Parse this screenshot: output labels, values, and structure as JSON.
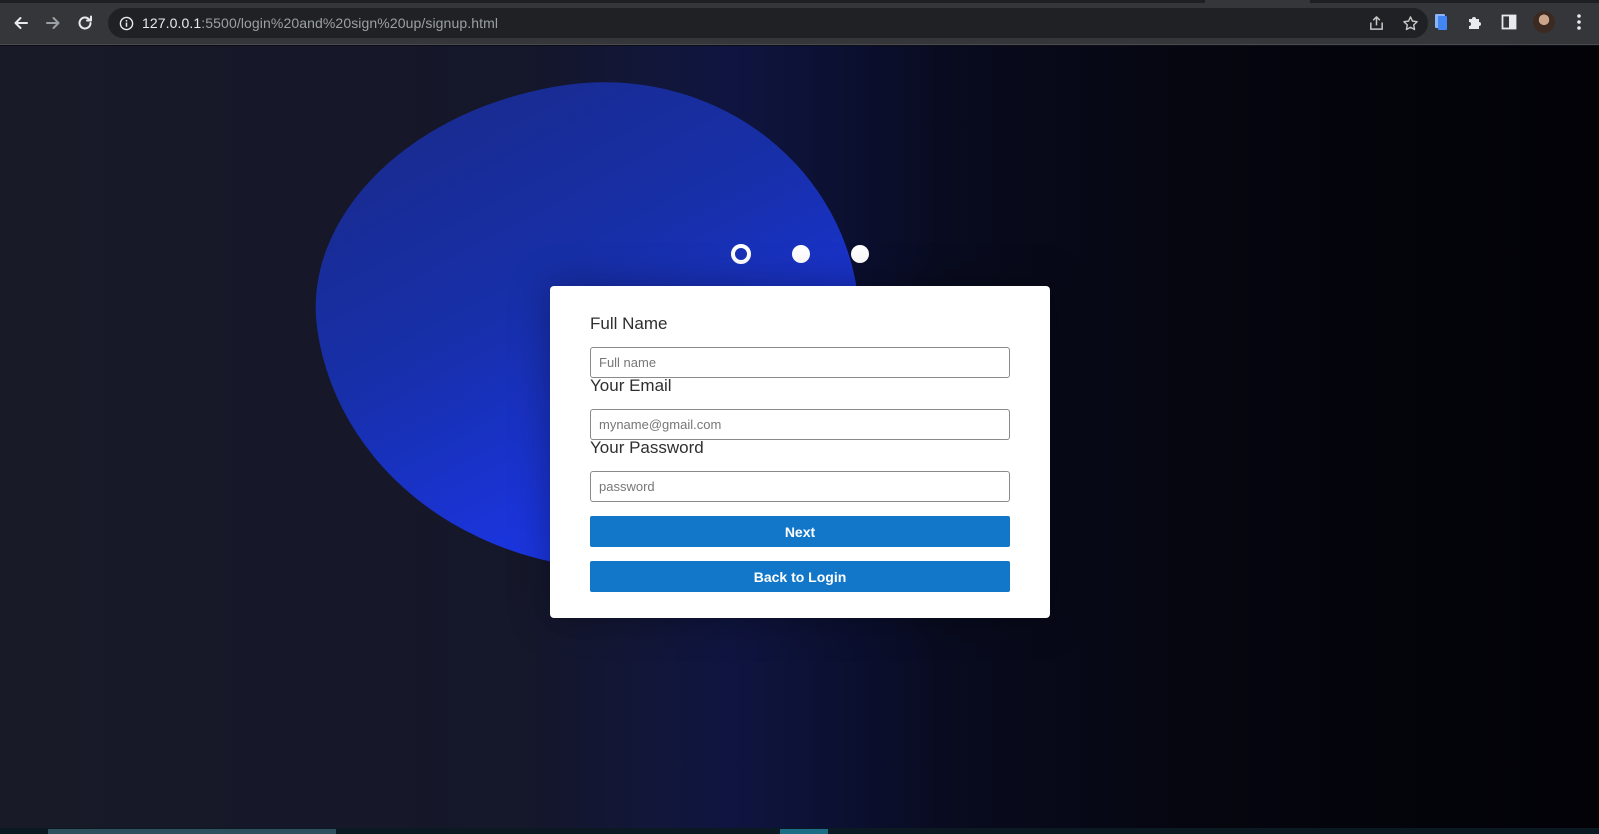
{
  "browser": {
    "url_host": "127.0.0.1",
    "url_rest": ":5500/login%20and%20sign%20up/signup.html",
    "icons": {
      "back": "arrow-left-icon",
      "forward": "arrow-right-icon",
      "reload": "reload-icon",
      "site_info": "info-icon",
      "share": "share-icon",
      "bookmark": "star-icon",
      "extension_1": "document-extension-icon",
      "extensions": "puzzle-icon",
      "side_panel": "side-panel-icon",
      "profile": "avatar",
      "menu": "kebab-menu-icon"
    }
  },
  "steps": {
    "count": 3,
    "active_index": 0
  },
  "form": {
    "full_name_label": "Full Name",
    "full_name_placeholder": "Full name",
    "email_label": "Your Email",
    "email_placeholder": "myname@gmail.com",
    "password_label": "Your Password",
    "password_placeholder": "password",
    "next_label": "Next",
    "back_label": "Back to Login"
  },
  "colors": {
    "button": "#1277c9",
    "blob": "#1e3cff",
    "background": "#14162a"
  }
}
